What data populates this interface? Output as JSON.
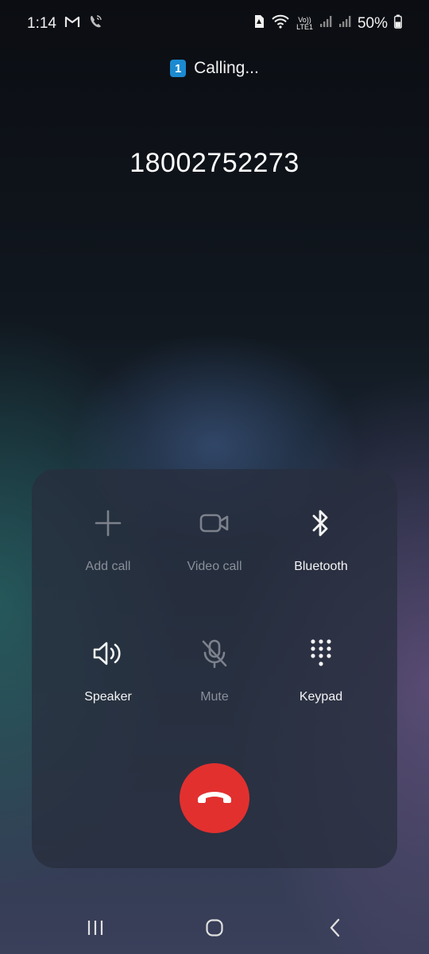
{
  "status_bar": {
    "time": "1:14",
    "battery": "50%",
    "icons": [
      "gmail-icon",
      "wifi-calling-icon",
      "sim-alert-icon",
      "wifi-icon",
      "volte-icon",
      "signal-icon",
      "signal-icon-2",
      "battery-icon"
    ],
    "volte_top": "Vo))",
    "volte_bottom": "LTE1"
  },
  "call": {
    "sim_slot": "1",
    "status": "Calling...",
    "number": "18002752273"
  },
  "controls": [
    {
      "label": "Add call",
      "icon": "plus-icon",
      "enabled": false
    },
    {
      "label": "Video call",
      "icon": "video-camera-icon",
      "enabled": false
    },
    {
      "label": "Bluetooth",
      "icon": "bluetooth-icon",
      "enabled": true
    },
    {
      "label": "Speaker",
      "icon": "speaker-icon",
      "enabled": true
    },
    {
      "label": "Mute",
      "icon": "mic-off-icon",
      "enabled": false
    },
    {
      "label": "Keypad",
      "icon": "keypad-icon",
      "enabled": true
    }
  ],
  "end_call": {
    "icon": "end-call-icon",
    "color": "#e2302f"
  },
  "nav_bar": {
    "buttons": [
      "recent-apps-icon",
      "home-icon",
      "back-icon"
    ]
  },
  "colors": {
    "accent_sim": "#1b8ad0",
    "end_call": "#e2302f",
    "disabled_label": "#8a8f9a"
  }
}
